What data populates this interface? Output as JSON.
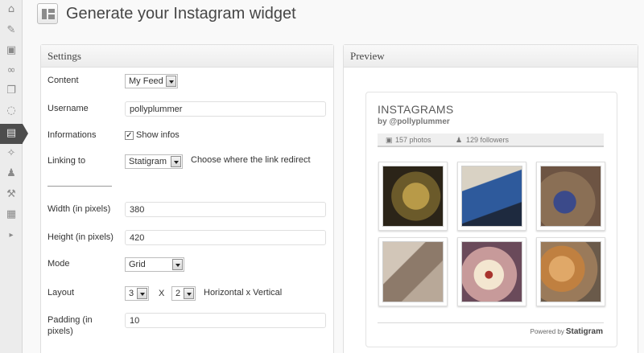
{
  "header": {
    "title": "Generate your Instagram widget"
  },
  "sidebar": {
    "icons": [
      {
        "name": "dashboard-icon",
        "glyph": "⌂"
      },
      {
        "name": "pin-icon",
        "glyph": "✎"
      },
      {
        "name": "media-icon",
        "glyph": "▣"
      },
      {
        "name": "link-icon",
        "glyph": "∞"
      },
      {
        "name": "pages-icon",
        "glyph": "❐"
      },
      {
        "name": "comments-icon",
        "glyph": "◌"
      },
      {
        "name": "appearance-icon",
        "glyph": "▤"
      },
      {
        "name": "plugins-icon",
        "glyph": "✧"
      },
      {
        "name": "users-icon",
        "glyph": "♟"
      },
      {
        "name": "tools-icon",
        "glyph": "⚒"
      },
      {
        "name": "settings-icon",
        "glyph": "▦"
      },
      {
        "name": "collapse-icon",
        "glyph": "▸"
      }
    ]
  },
  "settings": {
    "heading": "Settings",
    "content_label": "Content",
    "content_value": "My Feed",
    "username_label": "Username",
    "username_value": "pollyplummer",
    "informations_label": "Informations",
    "show_infos_label": "Show infos",
    "show_infos_checked": "✓",
    "linking_label": "Linking to",
    "linking_value": "Statigram",
    "linking_hint": "Choose where the link redirect",
    "width_label": "Width (in pixels)",
    "width_value": "380",
    "height_label": "Height (in pixels)",
    "height_value": "420",
    "mode_label": "Mode",
    "mode_value": "Grid",
    "layout_label": "Layout",
    "layout_h": "3",
    "layout_x": "X",
    "layout_v": "2",
    "layout_hint": "Horizontal x Vertical",
    "padding_label": "Padding (in pixels)",
    "padding_value": "10"
  },
  "preview": {
    "heading": "Preview",
    "widget_title": "INSTAGRAMS",
    "widget_by": "by @pollyplummer",
    "photos_count": "157 photos",
    "followers_count": "129 followers",
    "powered_by": "Powered by",
    "brand": "Statigram",
    "photos": [
      {
        "name": "photo-knitted-swatch",
        "bg": "#6b5a2a",
        "accent": "#a08a3c"
      },
      {
        "name": "photo-dog-blue-sweater",
        "bg": "#2e5a9c",
        "accent": "#c9c2b4"
      },
      {
        "name": "photo-dog-sitting",
        "bg": "#8a6f55",
        "accent": "#3b4a8a"
      },
      {
        "name": "photo-sleeping-dog",
        "bg": "#b8a898",
        "accent": "#8d7a6a"
      },
      {
        "name": "photo-cocktail-glass",
        "bg": "#c79a9a",
        "accent": "#f3e6d0"
      },
      {
        "name": "photo-orange-cat",
        "bg": "#9a7a5a",
        "accent": "#d8a060"
      }
    ]
  }
}
